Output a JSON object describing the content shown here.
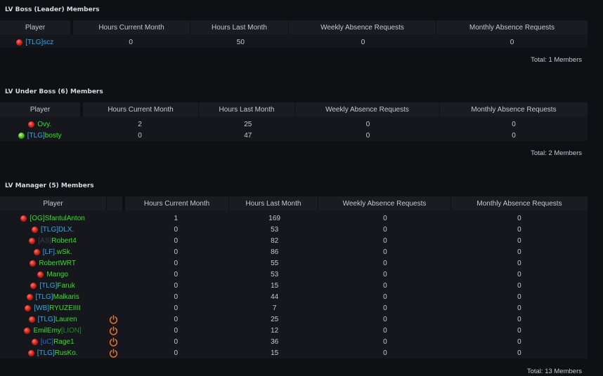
{
  "colors": {
    "background": "#0f1014",
    "header_bg": "#1a1c22",
    "row_bg": "#15171c",
    "name_green": "#35e02a",
    "tag_blue": "#33a8e8",
    "power_orange": "#e8742a"
  },
  "columns": {
    "player": "Player",
    "hours_current": "Hours Current Month",
    "hours_last": "Hours Last Month",
    "weekly": "Weekly Absence Requests",
    "monthly": "Monthly Absence Requests"
  },
  "sections": [
    {
      "title": "LV Boss (Leader) Members",
      "total": "Total: 1 Members",
      "members": [
        {
          "status": "red",
          "tag": "[TLG]",
          "tag_color": "blue",
          "name": "scz",
          "name_color": "blue",
          "suffix": "",
          "hours_current": "0",
          "hours_last": "50",
          "weekly": "0",
          "monthly": "0",
          "power": false
        }
      ]
    },
    {
      "title": "LV Under Boss (6) Members",
      "total": "Total: 2 Members",
      "members": [
        {
          "status": "red",
          "tag": "",
          "tag_color": "",
          "name": "Ovy.",
          "name_color": "green",
          "suffix": "",
          "hours_current": "2",
          "hours_last": "25",
          "weekly": "0",
          "monthly": "0",
          "power": false
        },
        {
          "status": "green",
          "tag": "[TLG]",
          "tag_color": "blue",
          "name": "bosty",
          "name_color": "green",
          "suffix": "",
          "hours_current": "0",
          "hours_last": "47",
          "weekly": "0",
          "monthly": "0",
          "power": false
        }
      ]
    },
    {
      "title": "LV Manager (5) Members",
      "total": "Total: 13 Members",
      "members": [
        {
          "status": "red",
          "tag": "[OG]",
          "tag_color": "green",
          "name": "SfantulAnton",
          "name_color": "green",
          "suffix": "",
          "hours_current": "1",
          "hours_last": "169",
          "weekly": "0",
          "monthly": "0",
          "power": false
        },
        {
          "status": "red",
          "tag": "[TLG]",
          "tag_color": "blue",
          "name": "DLX.",
          "name_color": "blue",
          "suffix": "",
          "hours_current": "0",
          "hours_last": "53",
          "weekly": "0",
          "monthly": "0",
          "power": false
        },
        {
          "status": "red",
          "tag": "[AS]",
          "tag_color": "dim",
          "name": "Robert4",
          "name_color": "green",
          "suffix": "",
          "hours_current": "0",
          "hours_last": "82",
          "weekly": "0",
          "monthly": "0",
          "power": false
        },
        {
          "status": "red",
          "tag": "[LF]",
          "tag_color": "blue",
          "name": ".wSk.",
          "name_color": "green",
          "suffix": "",
          "hours_current": "0",
          "hours_last": "86",
          "weekly": "0",
          "monthly": "0",
          "power": false
        },
        {
          "status": "red",
          "tag": "",
          "tag_color": "",
          "name": "RobertWRT",
          "name_color": "green",
          "suffix": "",
          "hours_current": "0",
          "hours_last": "55",
          "weekly": "0",
          "monthly": "0",
          "power": false
        },
        {
          "status": "red",
          "tag": "",
          "tag_color": "",
          "name": "Mango",
          "name_color": "green",
          "suffix": "",
          "hours_current": "0",
          "hours_last": "53",
          "weekly": "0",
          "monthly": "0",
          "power": false
        },
        {
          "status": "red",
          "tag": "[TLG]",
          "tag_color": "blue",
          "name": "Faruk",
          "name_color": "green",
          "suffix": "",
          "hours_current": "0",
          "hours_last": "15",
          "weekly": "0",
          "monthly": "0",
          "power": false
        },
        {
          "status": "red",
          "tag": "[TLG]",
          "tag_color": "blue",
          "name": "Malkaris",
          "name_color": "green",
          "suffix": "",
          "hours_current": "0",
          "hours_last": "44",
          "weekly": "0",
          "monthly": "0",
          "power": false
        },
        {
          "status": "red",
          "tag": "[WB]",
          "tag_color": "blue",
          "name": "RYUZEIIII",
          "name_color": "green",
          "suffix": "",
          "hours_current": "0",
          "hours_last": "7",
          "weekly": "0",
          "monthly": "0",
          "power": false
        },
        {
          "status": "red",
          "tag": "[TLG]",
          "tag_color": "blue",
          "name": "Lauren",
          "name_color": "green",
          "suffix": "",
          "hours_current": "0",
          "hours_last": "25",
          "weekly": "0",
          "monthly": "0",
          "power": true
        },
        {
          "status": "red",
          "tag": "",
          "tag_color": "",
          "name": "EmilEmy",
          "name_color": "green",
          "suffix": "[LION]",
          "hours_current": "0",
          "hours_last": "12",
          "weekly": "0",
          "monthly": "0",
          "power": true
        },
        {
          "status": "red",
          "tag": "[uC]",
          "tag_color": "navy",
          "name": "Rage1",
          "name_color": "green",
          "suffix": "",
          "hours_current": "0",
          "hours_last": "36",
          "weekly": "0",
          "monthly": "0",
          "power": true
        },
        {
          "status": "red",
          "tag": "[TLG]",
          "tag_color": "blue",
          "name": "RusKo.",
          "name_color": "green",
          "suffix": "",
          "hours_current": "0",
          "hours_last": "15",
          "weekly": "0",
          "monthly": "0",
          "power": true
        }
      ]
    }
  ]
}
